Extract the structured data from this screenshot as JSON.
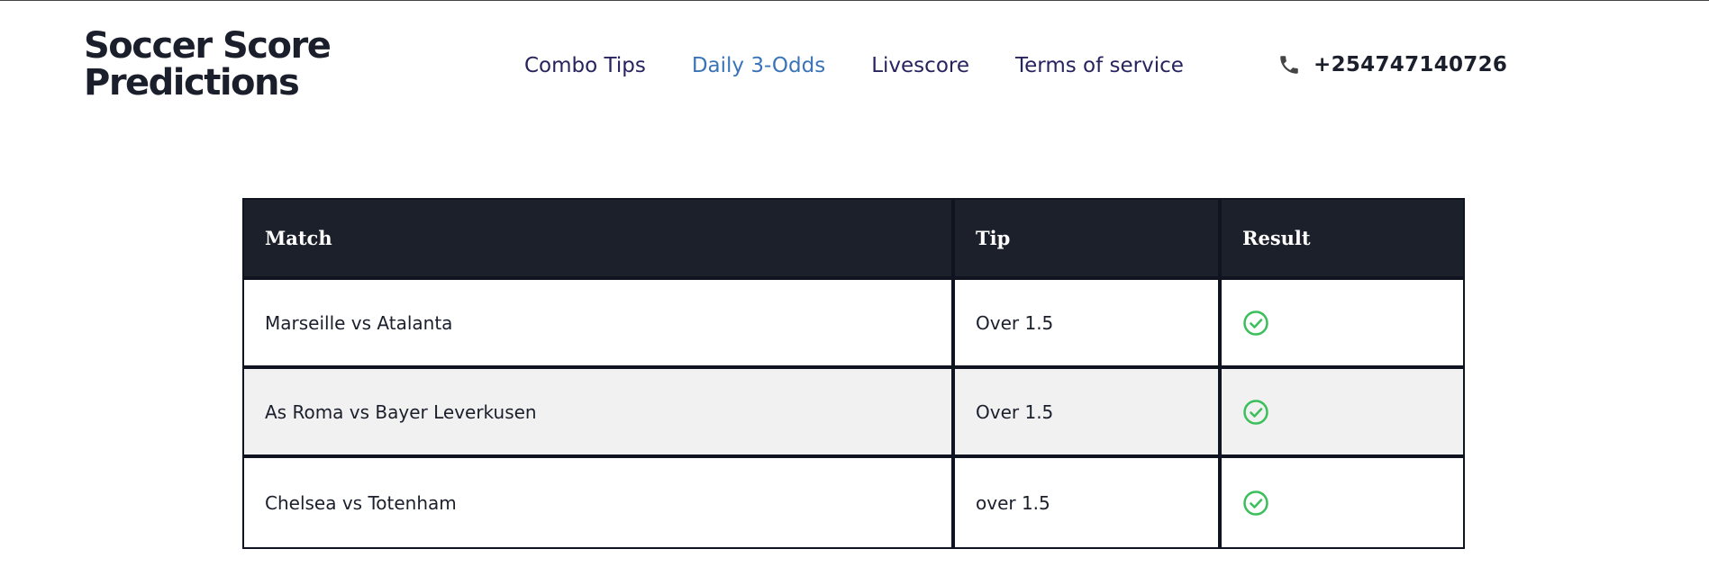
{
  "site": {
    "logo_line1": "Soccer Score",
    "logo_line2": "Predictions"
  },
  "nav": {
    "items": [
      {
        "label": "Combo Tips",
        "active": false
      },
      {
        "label": "Daily 3-Odds",
        "active": true
      },
      {
        "label": "Livescore",
        "active": false
      },
      {
        "label": "Terms of service",
        "active": false
      }
    ]
  },
  "contact": {
    "icon": "phone-icon",
    "phone": "+254747140726"
  },
  "table": {
    "headers": [
      "Match",
      "Tip",
      "Result"
    ],
    "rows": [
      {
        "match": "Marseille vs Atalanta",
        "tip": "Over 1.5",
        "result": "won",
        "result_icon": "check-circle-icon"
      },
      {
        "match": "As Roma vs Bayer Leverkusen",
        "tip": "Over 1.5",
        "result": "won",
        "result_icon": "check-circle-icon"
      },
      {
        "match": "Chelsea vs Totenham",
        "tip": "over 1.5",
        "result": "won",
        "result_icon": "check-circle-icon"
      }
    ]
  },
  "colors": {
    "nav_text": "#27235e",
    "nav_active": "#3a74b8",
    "header_bg": "#1c202b",
    "row_alt_bg": "#f1f1f1",
    "success_green": "#3bbf5a"
  }
}
